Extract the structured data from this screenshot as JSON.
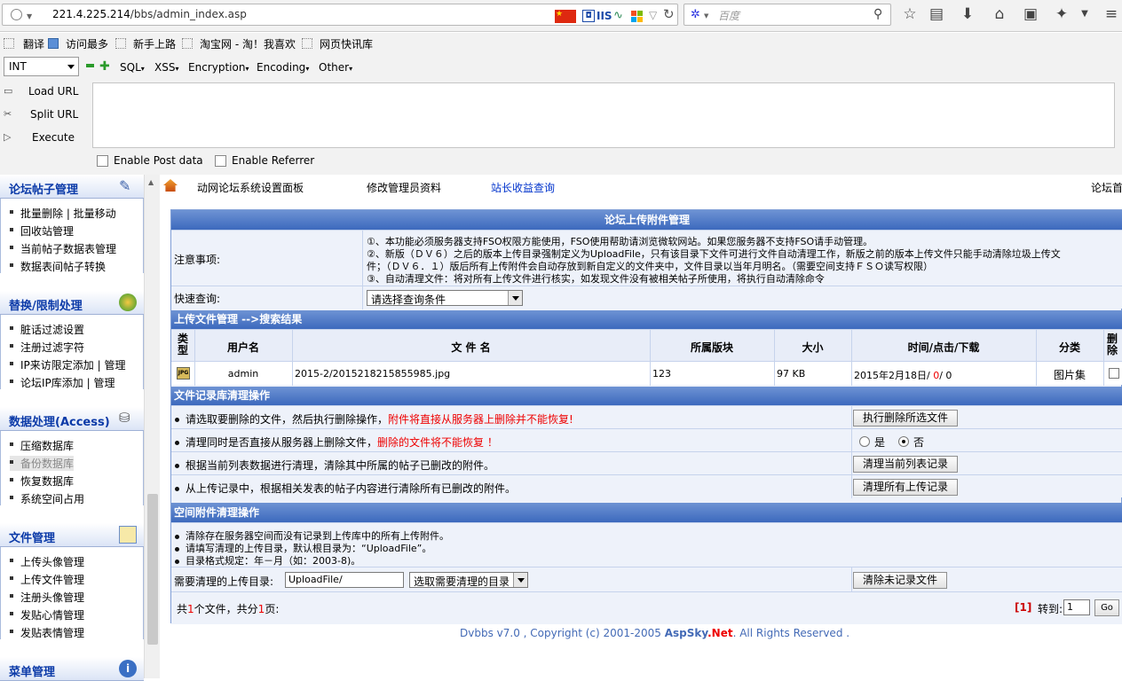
{
  "browser": {
    "url_host": "221.4.225.214",
    "url_path": "/bbs/admin_index.asp",
    "compat_label": "IIS",
    "search_placeholder": "百度"
  },
  "bookmarks": [
    "翻译",
    "访问最多",
    "新手上路",
    "淘宝网 - 淘！我喜欢",
    "网页快讯库"
  ],
  "hackbar": {
    "type_select": "INT",
    "menus": [
      "SQL",
      "XSS",
      "Encryption",
      "Encoding",
      "Other"
    ],
    "load_url": "Load URL",
    "split_url": "Split URL",
    "execute": "Execute",
    "enable_post": "Enable Post data",
    "enable_referrer": "Enable Referrer"
  },
  "sidebar": {
    "sections": [
      {
        "title": "论坛帖子管理",
        "items": [
          "批量删除 | 批量移动",
          "回收站管理",
          "当前帖子数据表管理",
          "数据表间帖子转换"
        ]
      },
      {
        "title": "替换/限制处理",
        "items": [
          "脏话过滤设置",
          "注册过滤字符",
          "IP来访限定添加 | 管理",
          "论坛IP库添加 | 管理"
        ]
      },
      {
        "title": "数据处理(Access)",
        "items": [
          "压缩数据库",
          "备份数据库",
          "恢复数据库",
          "系统空间占用"
        ]
      },
      {
        "title": "文件管理",
        "items": [
          "上传头像管理",
          "上传文件管理",
          "注册头像管理",
          "发贴心情管理",
          "发贴表情管理"
        ]
      },
      {
        "title": "菜单管理",
        "items": []
      }
    ]
  },
  "toplinks": [
    "动网论坛系统设置面板",
    "修改管理员资料",
    "站长收益查询",
    "论坛首"
  ],
  "main": {
    "title": "论坛上传附件管理",
    "notice_label": "注意事项:",
    "notice_lines": [
      "①、本功能必须服务器支持FSO权限方能使用，FSO使用帮助请浏览微软网站。如果您服务器不支持FSO请手动管理。",
      "②、新版（ＤＶ６）之后的版本上传目录强制定义为UploadFile，只有该目录下文件可进行文件自动清理工作，新版之前的版本上传文件只能手动清除垃圾上传文",
      "件；（ＤＶ６．１）版后所有上传附件会自动存放到新自定义的文件夹中，文件目录以当年月明名。（需要空间支持ＦＳＯ读写权限）",
      "③、自动清理文件：将对所有上传文件进行核实，如发现文件没有被相关帖子所使用，将执行自动清除命令"
    ],
    "quick_label": "快速查询:",
    "quick_select": "请选择查询条件",
    "results_title": "上传文件管理 -->搜索结果",
    "columns": [
      "类型",
      "用户名",
      "文 件 名",
      "所属版块",
      "大小",
      "时间/点击/下载",
      "分类",
      "删除"
    ],
    "file_row": {
      "icon": "JPG",
      "user": "admin",
      "file": "2015-2/2015218215855985.jpg",
      "board": "123",
      "size": "97 KB",
      "time": "2015年2月18日",
      "clicks": "0",
      "downloads": "0",
      "category": "图片集"
    },
    "clean_title": "文件记录库清理操作",
    "clean_rows": [
      {
        "text": "请选取要删除的文件，然后执行删除操作，",
        "red": "附件将直接从服务器上删除并不能恢复!",
        "button": "执行删除所选文件"
      },
      {
        "text": "清理同时是否直接从服务器上删除文件，",
        "red": "删除的文件将不能恢复 ！",
        "yes": "是",
        "no": "否"
      },
      {
        "text": "根据当前列表数据进行清理，清除其中所属的帖子已删改的附件。",
        "red": "",
        "button": "清理当前列表记录"
      },
      {
        "text": "从上传记录中，根据相关发表的帖子内容进行清除所有已删改的附件。",
        "red": "",
        "button": "清理所有上传记录"
      }
    ],
    "space_title": "空间附件清理操作",
    "space_lines": [
      "清除存在服务器空间而没有记录到上传库中的所有上传附件。",
      "请填写清理的上传目录，默认根目录为：“UploadFile”。",
      "目录格式规定：年－月（如：2003-8)。"
    ],
    "dir_label": "需要清理的上传目录:",
    "dir_value": "UploadFile/",
    "dir_select": "选取需要清理的目录",
    "clean_unrecorded": "清除未记录文件",
    "summary_prefix": "共",
    "summary_files": "1",
    "summary_mid": "个文件，共分",
    "summary_pages": "1",
    "summary_suffix": "页:",
    "page_current": "[1]",
    "goto_label": "转到:",
    "goto_value": "1",
    "go_button": "Go"
  },
  "footer": {
    "prefix": "Dvbbs v7.0 , Copyright (c) 2001-2005",
    "brand": "AspSky",
    "net": ".Net",
    "suffix": ". All Rights Reserved ."
  }
}
